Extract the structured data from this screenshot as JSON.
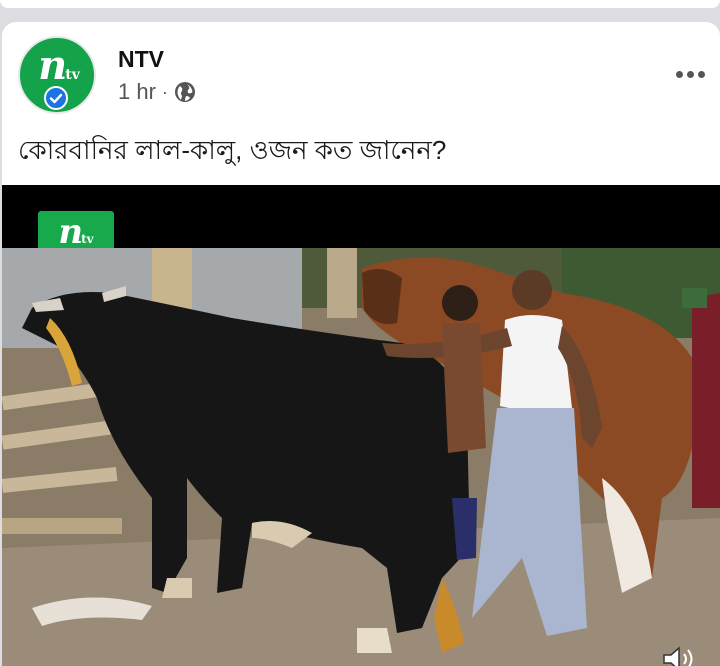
{
  "post": {
    "page_name": "NTV",
    "time_ago": "1 hr",
    "separator": "·",
    "text": "কোরবানির লাল-কালু, ওজন কত জানেন?",
    "avatar_logo": "n",
    "avatar_logo_sub": "tv"
  },
  "video": {
    "channel_logo": "n",
    "channel_logo_sub": "tv"
  },
  "icons": {
    "verified": "verified-badge-icon",
    "audience": "globe-icon",
    "more": "more-options-icon",
    "volume": "volume-icon"
  },
  "colors": {
    "brand_green": "#14a24a",
    "verified_blue": "#1b74e4",
    "background": "#dcdde1"
  }
}
